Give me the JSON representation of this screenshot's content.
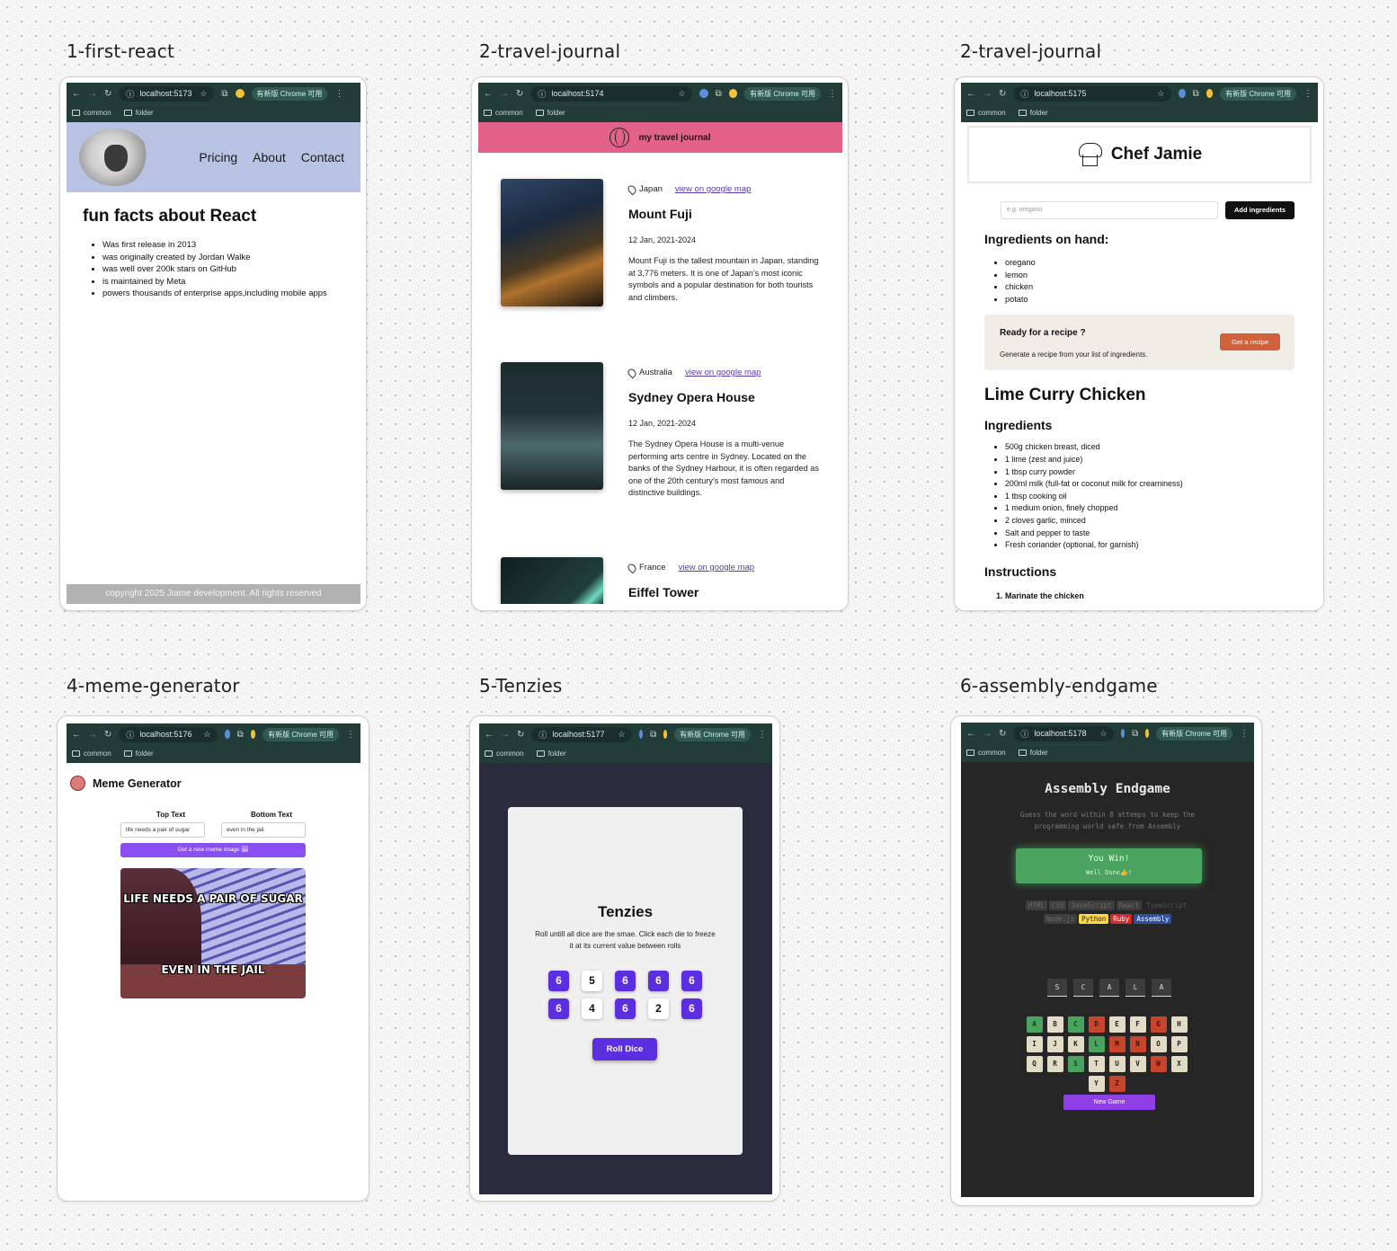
{
  "frames": [
    {
      "id": "first-react",
      "title": "1-first-react"
    },
    {
      "id": "travel-journal",
      "title": "2-travel-journal"
    },
    {
      "id": "chef-jamie",
      "title": "2-travel-journal"
    },
    {
      "id": "meme-generator",
      "title": "4-meme-generator"
    },
    {
      "id": "tenzies",
      "title": "5-Tenzies"
    },
    {
      "id": "assembly-endgame",
      "title": "6-assembly-endgame"
    }
  ],
  "browser": {
    "bookmark_1": "common",
    "bookmark_2": "folder",
    "update_pill": "有新版 Chrome 可用",
    "urls": [
      "localhost:5173",
      "localhost:5174",
      "localhost:5175",
      "localhost:5176",
      "localhost:5177",
      "localhost:5178"
    ]
  },
  "first_react": {
    "nav": [
      "Pricing",
      "About",
      "Contact"
    ],
    "heading": "fun facts about React",
    "facts": [
      "Was first release in 2013",
      "was originally created by Jordan Walke",
      "was well over 200k stars on GitHub",
      "is maintained by Meta",
      "powers thousands of enterprise apps,including mobile apps"
    ],
    "footer": "copyright 2025 Jiame development. All rights reserved"
  },
  "travel_journal": {
    "header": "my travel journal",
    "map_link": "view on google map",
    "entries": [
      {
        "country": "Japan",
        "title": "Mount Fuji",
        "dates": "12 Jan, 2021-2024",
        "description": "Mount Fuji is the tallest mountain in Japan, standing at 3,776 meters. It is one of Japan's most iconic symbols and a popular destination for both tourists and climbers."
      },
      {
        "country": "Australia",
        "title": "Sydney Opera House",
        "dates": "12 Jan, 2021-2024",
        "description": "The Sydney Opera House is a multi-venue performing arts centre in Sydney. Located on the banks of the Sydney Harbour, it is often regarded as one of the 20th century's most famous and distinctive buildings."
      },
      {
        "country": "France",
        "title": "Eiffel Tower"
      }
    ]
  },
  "chef": {
    "title": "Chef Jamie",
    "input_placeholder": "e.g. oregano",
    "add_button": "Add ingredients",
    "on_hand_heading": "Ingredients on hand:",
    "on_hand": [
      "oregano",
      "lemon",
      "chicken",
      "potato"
    ],
    "ready_title": "Ready for a recipe ?",
    "ready_sub": "Generate a recipe from your list of ingredients.",
    "ready_button": "Get a recipe",
    "recipe_title": "Lime Curry Chicken",
    "ingredients_heading": "Ingredients",
    "ingredients": [
      "500g chicken breast, diced",
      "1 lime (zest and juice)",
      "1 tbsp curry powder",
      "200ml milk (full-fat or coconut milk for creaminess)",
      "1 tbsp cooking oil",
      "1 medium onion, finely chopped",
      "2 cloves garlic, minced",
      "Salt and pepper to taste",
      "Fresh coriander (optional, for garnish)"
    ],
    "instructions_heading": "Instructions",
    "instructions": [
      "Marinate the chicken"
    ]
  },
  "meme": {
    "title": "Meme Generator",
    "top_label": "Top Text",
    "bottom_label": "Bottom Text",
    "top_value": "life needs a pair of sugar",
    "bottom_value": "even in the jail",
    "button": "Get a new meme image 🖼",
    "caption_top": "LIFE NEEDS A PAIR OF SUGAR",
    "caption_bottom": "EVEN IN THE JAIL"
  },
  "tenzies": {
    "title": "Tenzies",
    "description": "Roll untill all dice are the smae. Click each die to freeze it at its current value between rolls",
    "dice": [
      {
        "value": "6",
        "held": true
      },
      {
        "value": "5",
        "held": false
      },
      {
        "value": "6",
        "held": true
      },
      {
        "value": "6",
        "held": true
      },
      {
        "value": "6",
        "held": true
      },
      {
        "value": "6",
        "held": true
      },
      {
        "value": "4",
        "held": false
      },
      {
        "value": "6",
        "held": true
      },
      {
        "value": "2",
        "held": false
      },
      {
        "value": "6",
        "held": true
      }
    ],
    "roll_button": "Roll Dice"
  },
  "assembly": {
    "title": "Assembly Endgame",
    "subtitle": "Guess the word within 8 attemps to keep the programming world safe from Assembly",
    "win_title": "You Win!",
    "win_sub": "Well Done👍!",
    "languages_row1": [
      {
        "name": "HTML",
        "bg": "#3d3d3d",
        "fg": "#6b6b6b"
      },
      {
        "name": "CSS",
        "bg": "#3d3d3d",
        "fg": "#6b6b6b"
      },
      {
        "name": "JavaScript",
        "bg": "#3d3d3d",
        "fg": "#6b6b6b"
      },
      {
        "name": "React",
        "bg": "#3d3d3d",
        "fg": "#6b6b6b"
      },
      {
        "name": "TypeScript",
        "bg": "#262626",
        "fg": "#555555"
      }
    ],
    "languages_row2": [
      {
        "name": "Node.js",
        "bg": "#3d3d3d",
        "fg": "#6b6b6b"
      },
      {
        "name": "Python",
        "bg": "#FFD742",
        "fg": "#1e1e1e"
      },
      {
        "name": "Ruby",
        "bg": "#D02B2B",
        "fg": "#ffffff"
      },
      {
        "name": "Assembly",
        "bg": "#2D519F",
        "fg": "#ffffff"
      }
    ],
    "word": [
      "S",
      "C",
      "A",
      "L",
      "A"
    ],
    "keyboard": [
      {
        "k": "A",
        "s": "ok"
      },
      {
        "k": "B",
        "s": ""
      },
      {
        "k": "C",
        "s": "ok"
      },
      {
        "k": "D",
        "s": "bad"
      },
      {
        "k": "E",
        "s": ""
      },
      {
        "k": "F",
        "s": ""
      },
      {
        "k": "G",
        "s": "bad"
      },
      {
        "k": "H",
        "s": ""
      },
      {
        "k": "I",
        "s": ""
      },
      {
        "k": "J",
        "s": ""
      },
      {
        "k": "K",
        "s": ""
      },
      {
        "k": "L",
        "s": "ok"
      },
      {
        "k": "M",
        "s": "bad"
      },
      {
        "k": "N",
        "s": "bad"
      },
      {
        "k": "O",
        "s": ""
      },
      {
        "k": "P",
        "s": ""
      },
      {
        "k": "Q",
        "s": ""
      },
      {
        "k": "R",
        "s": ""
      },
      {
        "k": "S",
        "s": "ok"
      },
      {
        "k": "T",
        "s": ""
      },
      {
        "k": "U",
        "s": ""
      },
      {
        "k": "V",
        "s": ""
      },
      {
        "k": "W",
        "s": "bad"
      },
      {
        "k": "X",
        "s": ""
      },
      {
        "k": "Y",
        "s": ""
      },
      {
        "k": "Z",
        "s": "bad"
      }
    ],
    "new_game": "New Game"
  }
}
